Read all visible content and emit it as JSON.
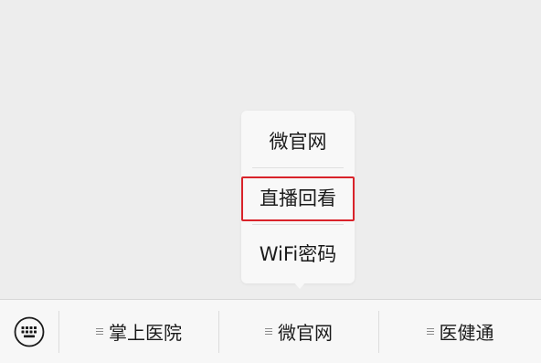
{
  "submenu": {
    "items": [
      {
        "label": "微官网"
      },
      {
        "label": "直播回看",
        "highlighted": true
      },
      {
        "label": "WiFi密码"
      }
    ],
    "highlight_color": "#d9232a"
  },
  "menu_bar": {
    "keyboard_icon": "keyboard-icon",
    "items": [
      {
        "label": "掌上医院",
        "icon": "submenu-lines-icon"
      },
      {
        "label": "微官网",
        "icon": "submenu-lines-icon"
      },
      {
        "label": "医健通",
        "icon": "submenu-lines-icon"
      }
    ]
  },
  "colors": {
    "background": "#ededed",
    "menu_bar": "#f7f7f7",
    "popup": "#f8f8f8"
  }
}
